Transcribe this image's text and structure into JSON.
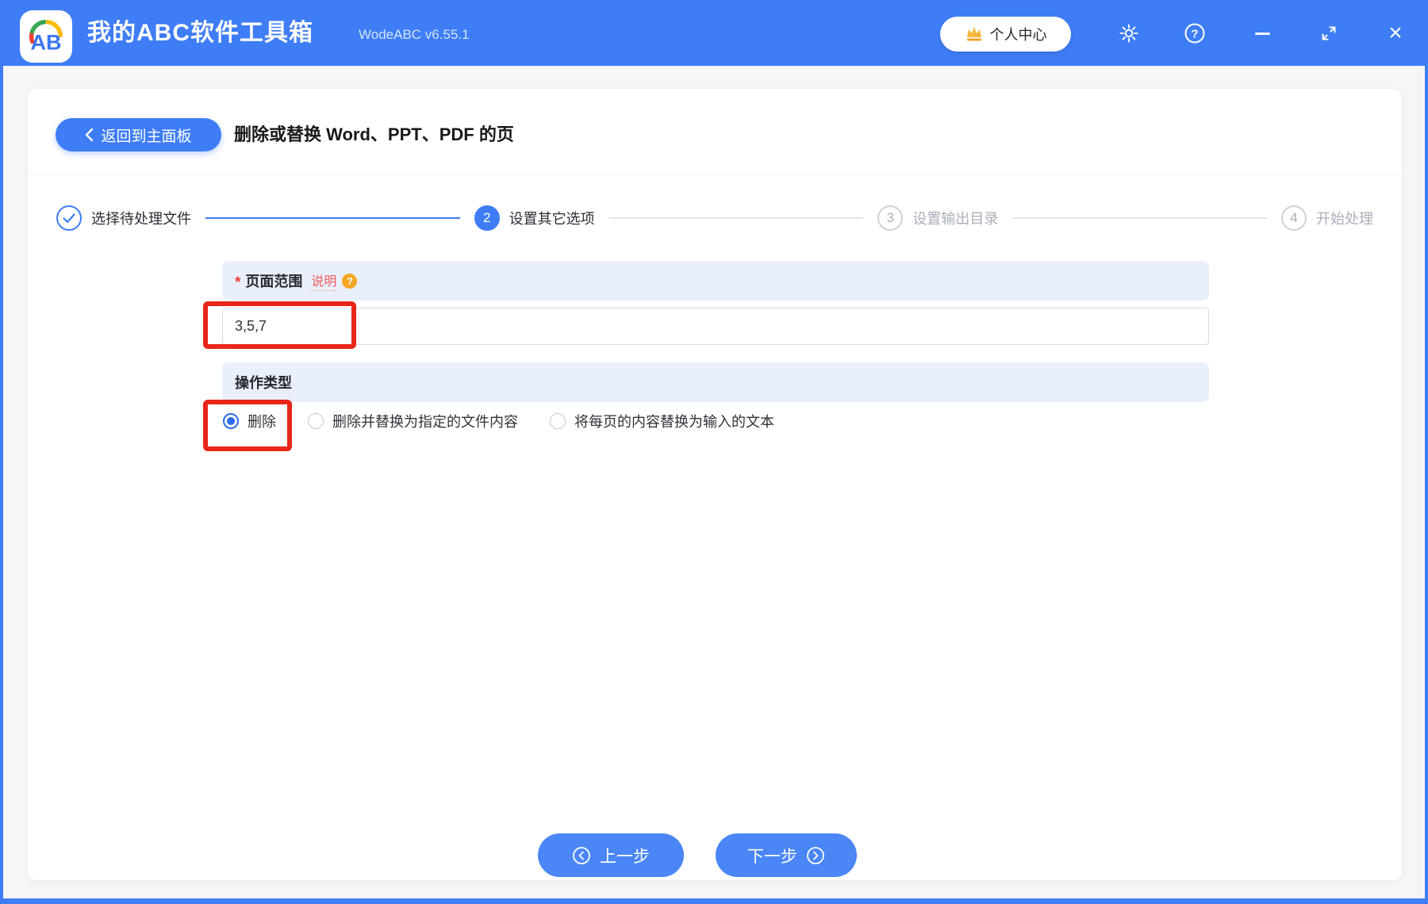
{
  "titlebar": {
    "logo_text": "AB",
    "app_title": "我的ABC软件工具箱",
    "version": "WodeABC v6.55.1",
    "personal_center_label": "个人中心",
    "close_glyph": "×"
  },
  "header": {
    "back_label": "返回到主面板",
    "title": "删除或替换 Word、PPT、PDF 的页"
  },
  "stepper": {
    "steps": [
      {
        "label": "选择待处理文件",
        "state": "done"
      },
      {
        "num": "2",
        "label": "设置其它选项",
        "state": "active"
      },
      {
        "num": "3",
        "label": "设置输出目录",
        "state": "pending"
      },
      {
        "num": "4",
        "label": "开始处理",
        "state": "pending"
      }
    ]
  },
  "form": {
    "page_range": {
      "required_mark": "*",
      "label": "页面范围",
      "help_link": "说明",
      "help_badge": "?",
      "value": "3,5,7"
    },
    "operation_type": {
      "label": "操作类型",
      "options": [
        {
          "label": "删除",
          "selected": true
        },
        {
          "label": "删除并替换为指定的文件内容",
          "selected": false
        },
        {
          "label": "将每页的内容替换为输入的文本",
          "selected": false
        }
      ]
    }
  },
  "footer": {
    "prev_label": "上一步",
    "next_label": "下一步"
  },
  "colors": {
    "primary_blue": "#3e7df6",
    "section_bar_bg": "#e9f0fc",
    "annotation_red": "#e8261a",
    "help_link_red": "#f15b5b",
    "help_badge_orange": "#f6a623",
    "pending_gray": "#a9aeb8"
  }
}
